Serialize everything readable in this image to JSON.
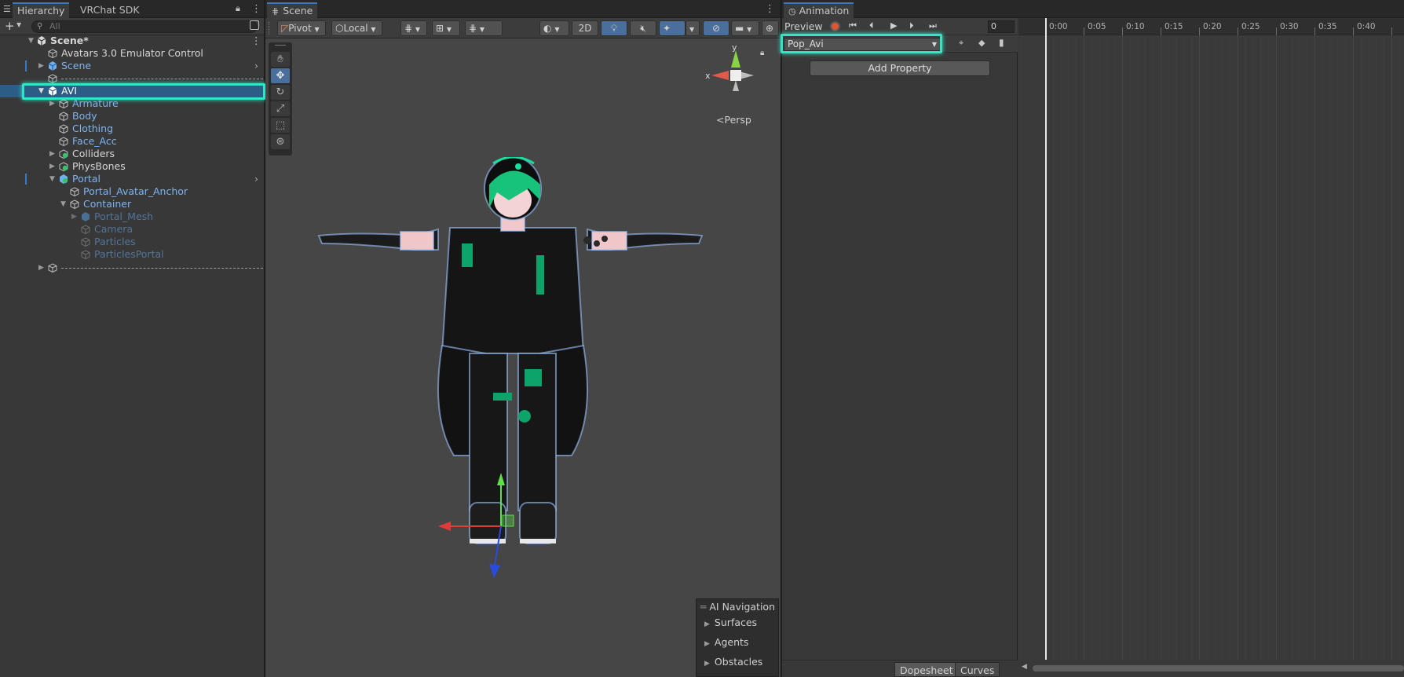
{
  "hierarchy": {
    "tabs": [
      "Hierarchy",
      "VRChat SDK"
    ],
    "search_placeholder": "All",
    "rows": [
      {
        "label": "Scene*"
      },
      {
        "label": "Avatars 3.0 Emulator Control"
      },
      {
        "label": "Scene"
      },
      {
        "label": ""
      },
      {
        "label": "AVI"
      },
      {
        "label": "Armature"
      },
      {
        "label": "Body"
      },
      {
        "label": "Clothing"
      },
      {
        "label": "Face_Acc"
      },
      {
        "label": "Colliders"
      },
      {
        "label": "PhysBones"
      },
      {
        "label": "Portal"
      },
      {
        "label": "Portal_Avatar_Anchor"
      },
      {
        "label": "Container"
      },
      {
        "label": "Portal_Mesh"
      },
      {
        "label": "Camera"
      },
      {
        "label": "Particles"
      },
      {
        "label": "ParticlesPortal"
      },
      {
        "label": ""
      }
    ]
  },
  "scene": {
    "tab": "Scene",
    "toolbar": {
      "pivot": "Pivot",
      "local": "Local",
      "mode_2d": "2D"
    },
    "gizmo": {
      "y": "y",
      "x": "x",
      "persp": "Persp"
    },
    "ai_navigation": {
      "title": "AI Navigation",
      "items": [
        "Surfaces",
        "Agents",
        "Obstacles"
      ]
    }
  },
  "animation": {
    "tab": "Animation",
    "preview_label": "Preview",
    "frame_value": "0",
    "clip": "Pop_Avi",
    "add_property": "Add Property",
    "bottom_tabs": [
      "Dopesheet",
      "Curves"
    ],
    "ruler_ticks": [
      "0:00",
      "0:05",
      "0:10",
      "0:15",
      "0:20",
      "0:25",
      "0:30",
      "0:35",
      "0:40"
    ]
  }
}
